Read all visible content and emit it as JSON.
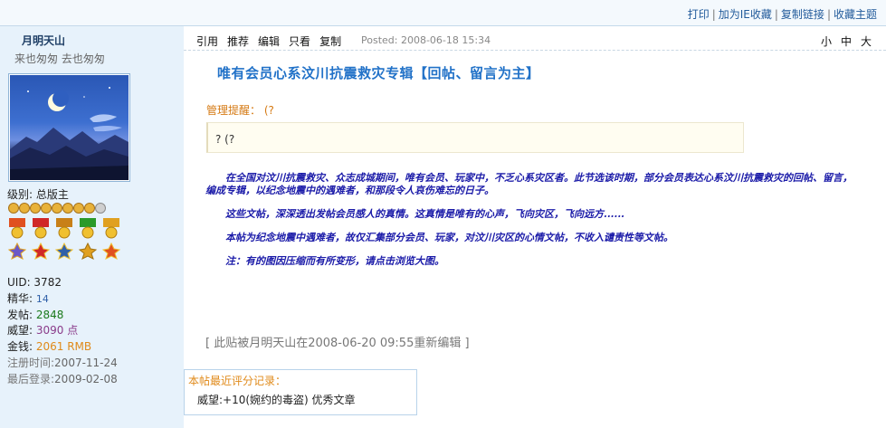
{
  "topbar": {
    "links": [
      "打印",
      "加为IE收藏",
      "复制链接",
      "收藏主题"
    ],
    "separator": "|"
  },
  "sidebar": {
    "username": "月明天山",
    "motto": "来也匆匆  去也匆匆",
    "level_label": "级别: 总版主",
    "stats": [
      {
        "key": "UID: ",
        "value": "3782",
        "style": "num"
      },
      {
        "key": "精华: ",
        "value": "14",
        "style": "blue"
      },
      {
        "key": "发帖: ",
        "value": "2848",
        "style": "green"
      },
      {
        "key": "威望: ",
        "value": "3090 点",
        "style": "purple"
      },
      {
        "key": "金钱: ",
        "value": "2061 RMB",
        "style": "orange"
      },
      {
        "key": "注册时间:",
        "value": "2007-11-24",
        "style": "gray"
      },
      {
        "key": "最后登录:",
        "value": "2009-02-08",
        "style": "gray"
      }
    ]
  },
  "post": {
    "actions": [
      "引用",
      "推荐",
      "编辑",
      "只看",
      "复制"
    ],
    "posted": "Posted: 2008-06-18 15:34",
    "font_sizes": [
      "小",
      "中",
      "大"
    ],
    "title": "唯有会员心系汶川抗震救灾专辑【回帖、留言为主】",
    "notice_label": "管理提醒：  (?",
    "notice_text": "? (?",
    "paragraphs": [
      "在全国对汶川抗震救灾、众志成城期间，唯有会员、玩家中，不乏心系灾区者。此节选该时期，部分会员表达心系汶川抗震救灾的回帖、留言，编成专辑，以纪念地震中的遇难者，和那段令人哀伤难忘的日子。",
      "这些文帖，深深透出发帖会员感人的真情。这真情是唯有的心声，飞向灾区，飞向远方......",
      "本帖为纪念地震中遇难者，故仅汇集部分会员、玩家，对汶川灾区的心情文帖，不收入谴责性等文帖。",
      "注：有的图因压缩而有所变形，请点击浏览大图。"
    ],
    "edited": "[ 此贴被月明天山在2008-06-20 09:55重新编辑  ]",
    "rating_title": "本帖最近评分记录：",
    "rating_text": "威望:+10(婉约的毒盗) 优秀文章"
  },
  "colors": {
    "accent": "#2272c8",
    "sidebar_bg": "#e7f2fb",
    "body_text": "#1a1aa8",
    "notice": "#d57a14"
  }
}
